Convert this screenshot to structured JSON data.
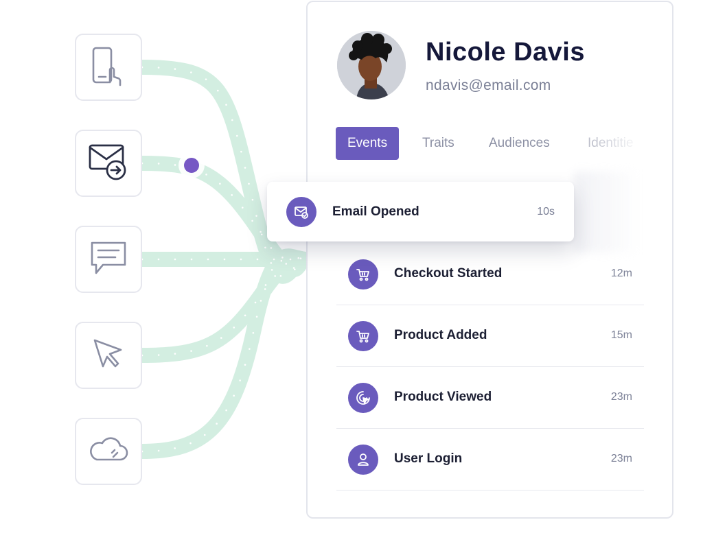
{
  "profile": {
    "name": "Nicole Davis",
    "email": "ndavis@email.com"
  },
  "tabs": [
    {
      "label": "Events",
      "active": true
    },
    {
      "label": "Traits",
      "active": false
    },
    {
      "label": "Audiences",
      "active": false
    },
    {
      "label": "Identitie",
      "active": false
    }
  ],
  "popup_event": {
    "label": "Email Opened",
    "time": "10s",
    "icon": "email-check-icon"
  },
  "events": [
    {
      "label": "Checkout Started",
      "time": "12m",
      "icon": "cart-icon"
    },
    {
      "label": "Product Added",
      "time": "15m",
      "icon": "cart-icon"
    },
    {
      "label": "Product Viewed",
      "time": "23m",
      "icon": "target-cursor-icon"
    },
    {
      "label": "User Login",
      "time": "23m",
      "icon": "user-icon"
    }
  ],
  "sources": [
    {
      "icon": "mobile-tap-icon"
    },
    {
      "icon": "email-send-icon"
    },
    {
      "icon": "chat-message-icon"
    },
    {
      "icon": "cursor-pointer-icon"
    },
    {
      "icon": "cloud-icon"
    }
  ],
  "colors": {
    "accent": "#6a5bbd",
    "flow": "#d3eee1",
    "text_dark": "#15183a",
    "text_muted": "#7a7f95"
  }
}
